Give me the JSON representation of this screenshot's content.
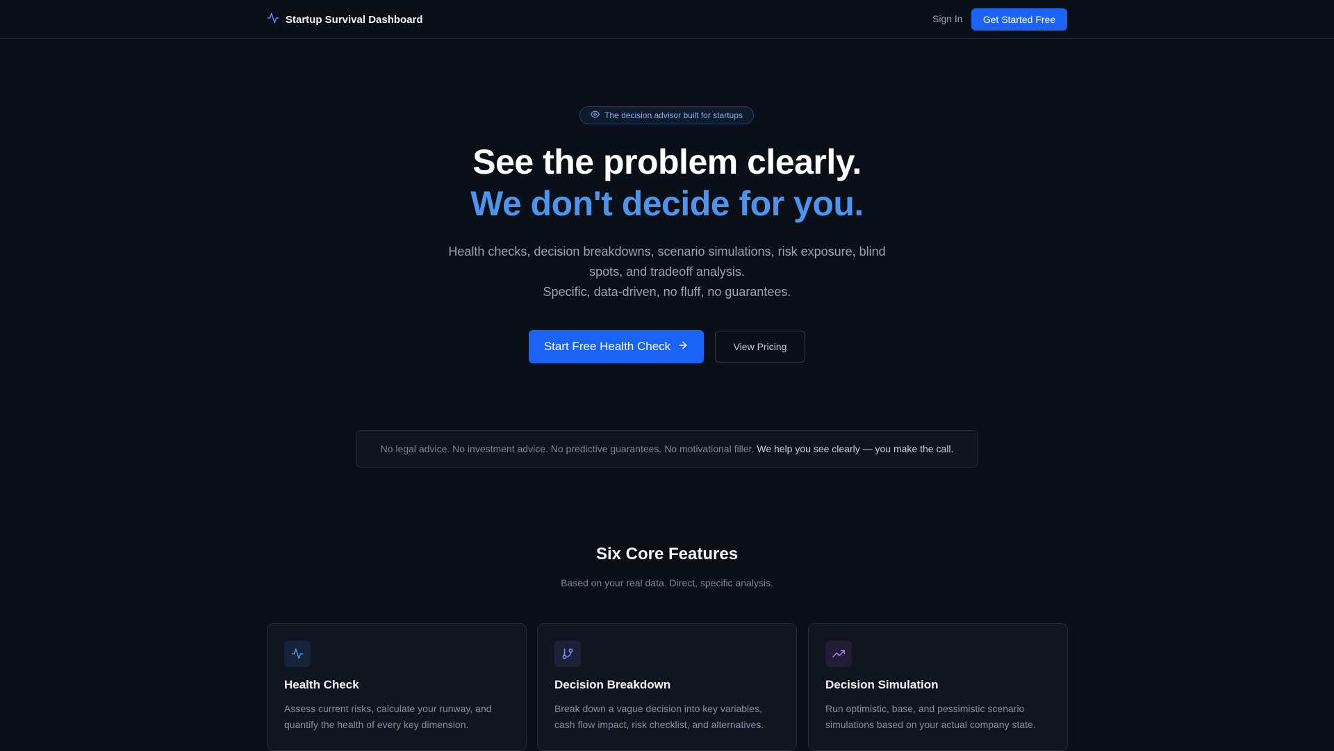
{
  "nav": {
    "brand": "Startup Survival Dashboard",
    "sign_in": "Sign In",
    "get_started": "Get Started Free"
  },
  "hero": {
    "badge": "The decision advisor built for startups",
    "title_line1": "See the problem clearly.",
    "title_line2": "We don't decide for you.",
    "subtitle_line1": "Health checks, decision breakdowns, scenario simulations, risk exposure, blind spots, and tradeoff analysis.",
    "subtitle_line2": "Specific, data-driven, no fluff, no guarantees.",
    "cta_primary": "Start Free Health Check",
    "cta_secondary": "View Pricing"
  },
  "disclaimer": {
    "muted": "No legal advice. No investment advice. No predictive guarantees. No motivational filler.",
    "emphasis": "We help you see clearly — you make the call."
  },
  "features": {
    "title": "Six Core Features",
    "subtitle": "Based on your real data. Direct, specific analysis.",
    "items": [
      {
        "icon": "activity-icon",
        "title": "Health Check",
        "description": "Assess current risks, calculate your runway, and quantify the health of every key dimension."
      },
      {
        "icon": "git-branch-icon",
        "title": "Decision Breakdown",
        "description": "Break down a vague decision into key variables, cash flow impact, risk checklist, and alternatives."
      },
      {
        "icon": "trending-up-icon",
        "title": "Decision Simulation",
        "description": "Run optimistic, base, and pessimistic scenario simulations based on your actual company state."
      }
    ]
  },
  "colors": {
    "background": "#0b0f18",
    "accent": "#1b63f6",
    "headline_accent": "#4b95ee",
    "card_bg": "#111520"
  }
}
